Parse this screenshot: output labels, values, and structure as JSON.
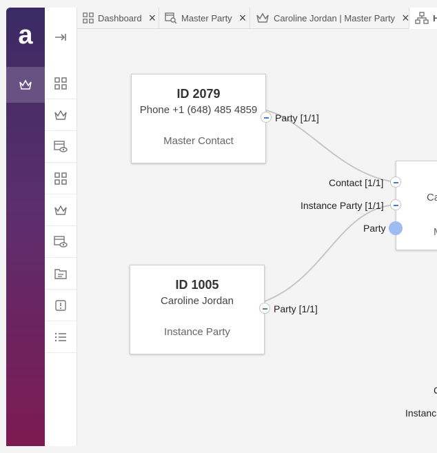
{
  "tabs": [
    {
      "label": "Dashboard",
      "icon": "grid-icon"
    },
    {
      "label": "Master Party",
      "icon": "table-search-icon"
    },
    {
      "label": "Caroline Jordan | Master Party",
      "icon": "crown-icon"
    },
    {
      "label": "H",
      "icon": "hierarchy-icon"
    }
  ],
  "logo": {
    "letter": "a"
  },
  "nodes": {
    "master": {
      "id": "ID 2079",
      "detail": "Phone +1 (648) 485 4859",
      "type": "Master Contact",
      "port_label": "Party [1/1]"
    },
    "instance": {
      "id": "ID 1005",
      "detail": "Caroline Jordan",
      "type": "Instance Party",
      "port_label": "Party [1/1]"
    },
    "center": {
      "partial_line1": "Ca",
      "partial_line2": "M",
      "ports": [
        "Contact [1/1]",
        "Instance Party [1/1]",
        "Party"
      ]
    }
  },
  "edge_labels": {
    "c": "C",
    "instanc": "Instanc"
  },
  "colors": {
    "accent": "#3c7be0",
    "port_fill": "#9fbcf2"
  }
}
